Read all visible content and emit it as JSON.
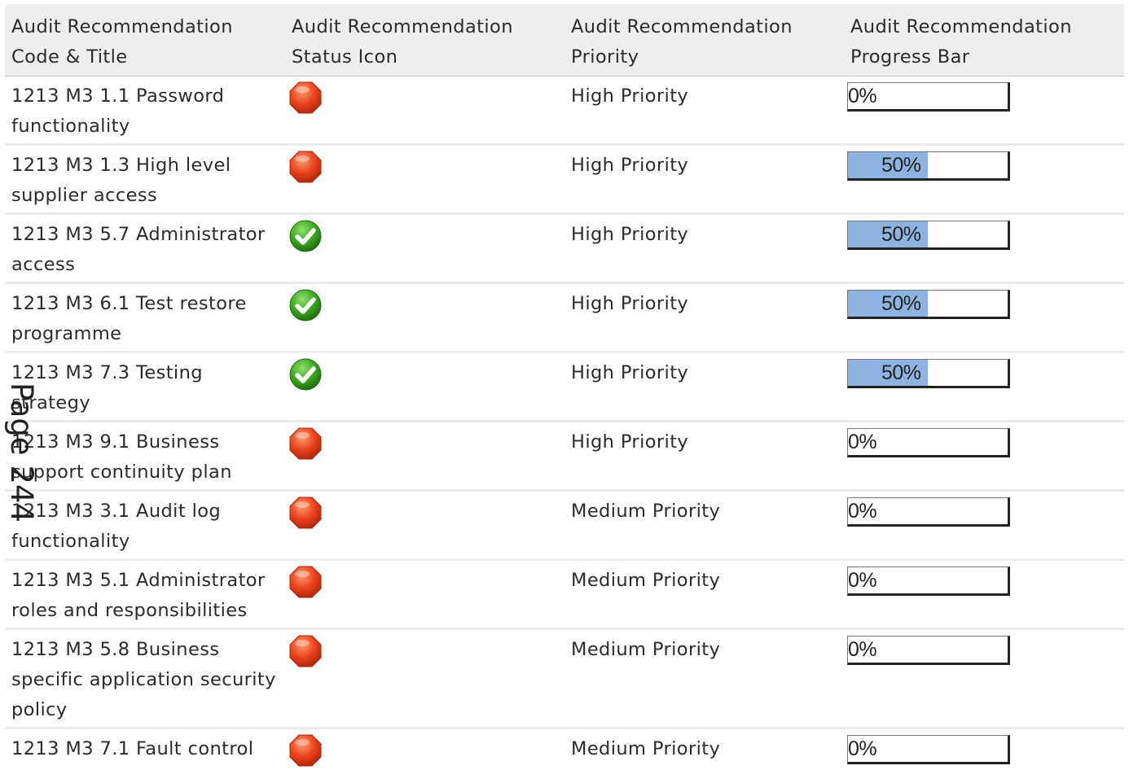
{
  "headers": {
    "code_title": "Audit Recommendation Code & Title",
    "status_icon": "Audit Recommendation Status Icon",
    "priority": "Audit Recommendation Priority",
    "progress_bar": "Audit Recommendation Progress Bar"
  },
  "rows": [
    {
      "title": "1213 M3 1.1 Password functionality",
      "status": "red-octagon-icon",
      "priority": "High Priority",
      "progress_label": "0%",
      "progress": 0
    },
    {
      "title": "1213 M3 1.3 High level supplier access",
      "status": "red-octagon-icon",
      "priority": "High Priority",
      "progress_label": "50%",
      "progress": 0.5
    },
    {
      "title": "1213 M3 5.7 Administrator access",
      "status": "green-check-icon",
      "priority": "High Priority",
      "progress_label": "50%",
      "progress": 0.5
    },
    {
      "title": "1213 M3 6.1 Test restore programme",
      "status": "green-check-icon",
      "priority": "High Priority",
      "progress_label": "50%",
      "progress": 0.5
    },
    {
      "title": "1213 M3 7.3 Testing strategy",
      "status": "green-check-icon",
      "priority": "High Priority",
      "progress_label": "50%",
      "progress": 0.5
    },
    {
      "title": "1213 M3 9.1 Business support continuity plan",
      "status": "red-octagon-icon",
      "priority": "High Priority",
      "progress_label": "0%",
      "progress": 0
    },
    {
      "title": "1213 M3 3.1 Audit log functionality",
      "status": "red-octagon-icon",
      "priority": "Medium Priority",
      "progress_label": "0%",
      "progress": 0
    },
    {
      "title": "1213 M3 5.1 Administrator roles and responsibilities",
      "status": "red-octagon-icon",
      "priority": "Medium Priority",
      "progress_label": "0%",
      "progress": 0
    },
    {
      "title": "1213 M3 5.8 Business specific application security policy",
      "status": "red-octagon-icon",
      "priority": "Medium Priority",
      "progress_label": "0%",
      "progress": 0
    },
    {
      "title": "1213 M3 7.1 Fault control",
      "status": "red-octagon-icon",
      "priority": "Medium Priority",
      "progress_label": "0%",
      "progress": 0
    }
  ],
  "colors": {
    "not_started": "#e8401c",
    "complete": "#3aa51f",
    "progress_fill": "#8fb3e0",
    "header_bg": "#eeeeee"
  },
  "watermark": "Page 244"
}
